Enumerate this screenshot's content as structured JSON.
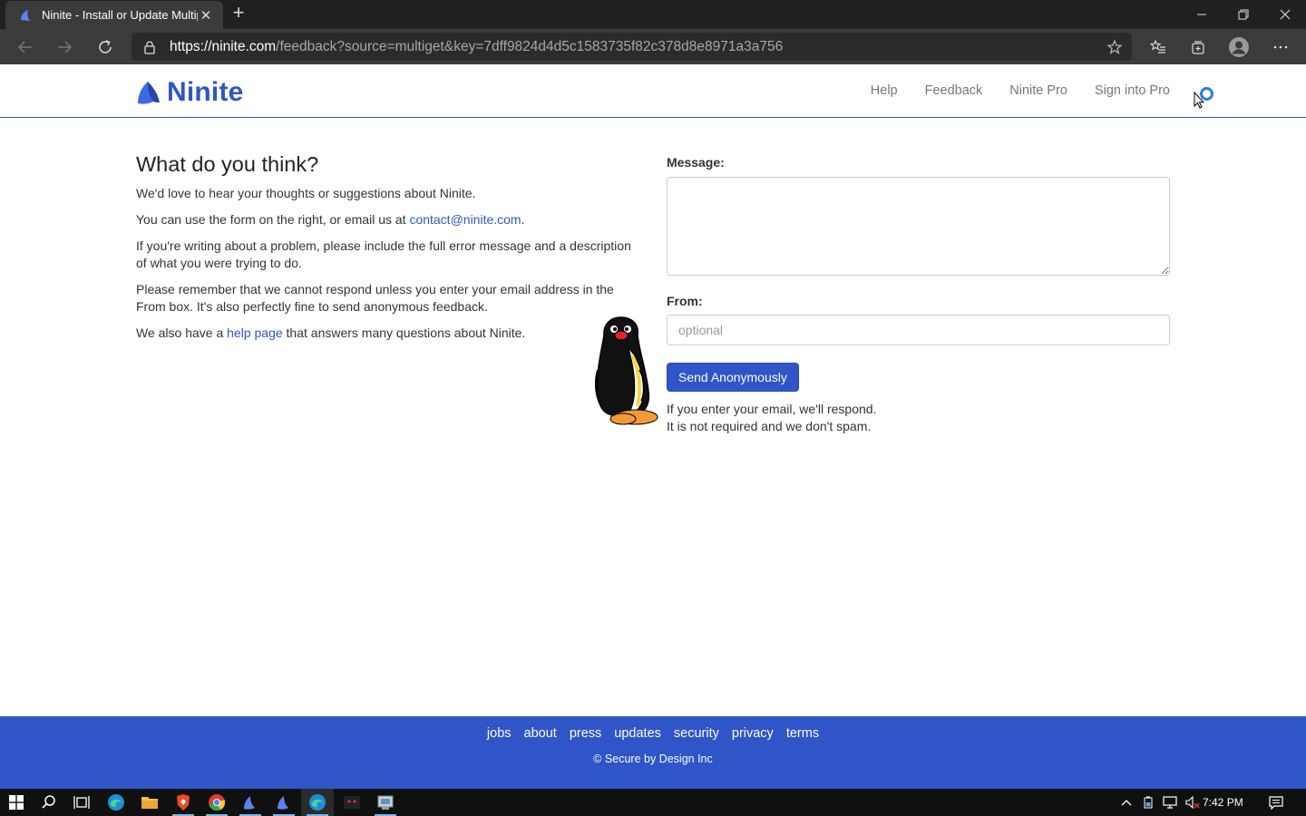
{
  "browser": {
    "tab_title": "Ninite - Install or Update Multipl",
    "url_host": "https://ninite.com",
    "url_path": "/feedback?source=multiget&key=7dff9824d4d5c1583735f82c378d8e8971a3a756"
  },
  "header": {
    "logo_text": "Ninite",
    "nav": [
      "Help",
      "Feedback",
      "Ninite Pro",
      "Sign into Pro"
    ]
  },
  "content": {
    "heading": "What do you think?",
    "p1": "We'd love to hear your thoughts or suggestions about Ninite.",
    "p2_pre": "You can use the form on the right, or email us at ",
    "p2_link": "contact@ninite.com",
    "p2_post": ".",
    "p3": "If you're writing about a problem, please include the full error message and a description of what you were trying to do.",
    "p4": "Please remember that we cannot respond unless you enter your email address in the From box. It's also perfectly fine to send anonymous feedback.",
    "p5_pre": "We also have a ",
    "p5_link": "help page",
    "p5_post": " that answers many questions about Ninite."
  },
  "form": {
    "message_label": "Message:",
    "message_value": "",
    "from_label": "From:",
    "from_placeholder": "optional",
    "send_label": "Send Anonymously",
    "note_line1": "If you enter your email, we'll respond.",
    "note_line2": "It is not required and we don't spam."
  },
  "footer": {
    "links": [
      "jobs",
      "about",
      "press",
      "updates",
      "security",
      "privacy",
      "terms"
    ],
    "copyright": "© Secure by Design Inc"
  },
  "taskbar": {
    "clock": "7:42 PM"
  },
  "colors": {
    "brand_blue": "#2f55c8",
    "chrome_dark": "#202020"
  }
}
